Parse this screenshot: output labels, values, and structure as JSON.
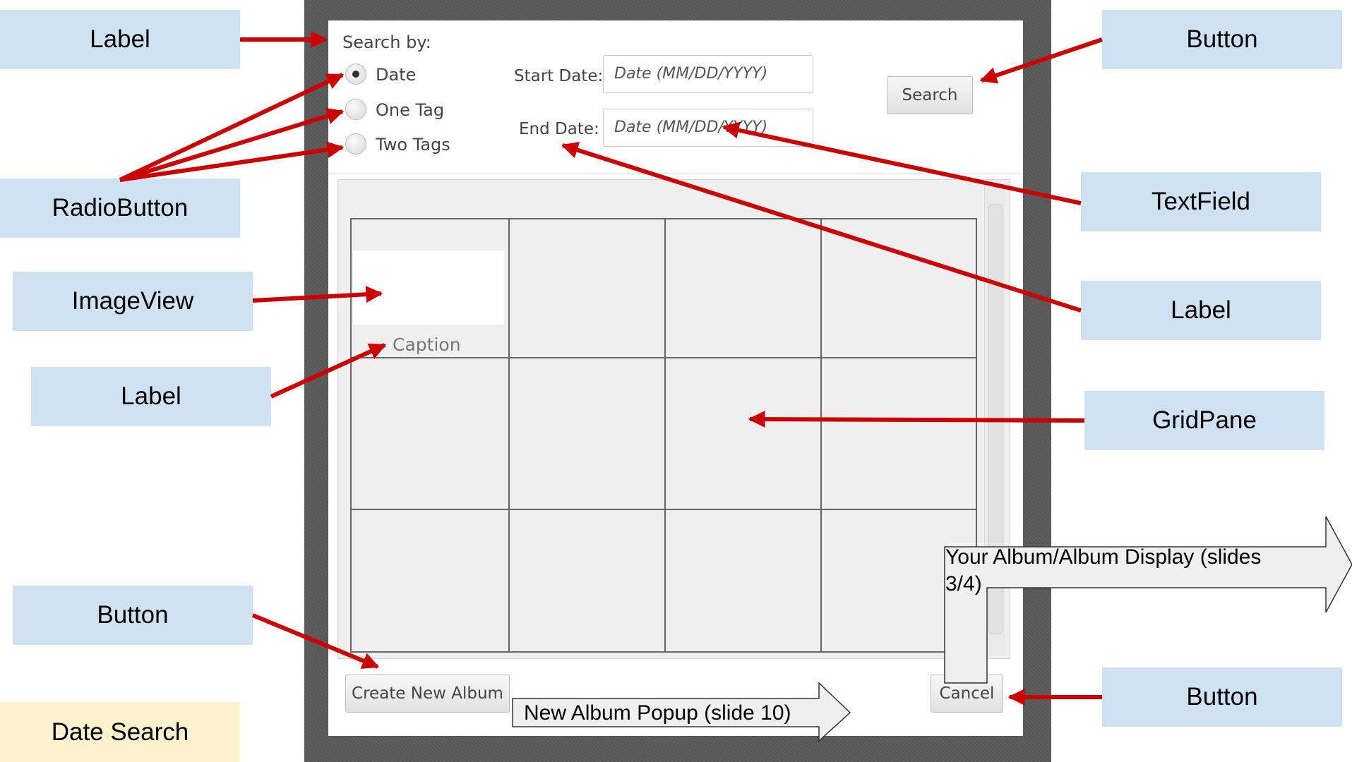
{
  "app": {
    "search_by": "Search by:",
    "radio_options": [
      {
        "label": "Date",
        "selected": true
      },
      {
        "label": "One Tag",
        "selected": false
      },
      {
        "label": "Two Tags",
        "selected": false
      }
    ],
    "start_date_label": "Start Date:",
    "end_date_label": "End Date:",
    "start_date_placeholder": "Date (MM/DD/YYYY)",
    "end_date_placeholder": "Date (MM/DD/YYYY)",
    "search_button": "Search",
    "caption": "Caption",
    "create_album_button": "Create New Album",
    "cancel_button": "Cancel"
  },
  "annotations": {
    "label_top_left": "Label",
    "radiobutton": "RadioButton",
    "imageview": "ImageView",
    "label_caption": "Label",
    "button_left": "Button",
    "date_search": "Date Search",
    "button_top_right": "Button",
    "textfield": "TextField",
    "label_right": "Label",
    "gridpane": "GridPane",
    "button_bottom_right": "Button"
  },
  "notes": {
    "new_album_popup": "New Album Popup (slide 10)",
    "album_display": "Your Album/Album Display (slides 3/4)"
  },
  "colors": {
    "callout_blue": "#cfe2f3",
    "callout_yellow": "#fff2cc",
    "arrow_red": "#cc0000"
  }
}
